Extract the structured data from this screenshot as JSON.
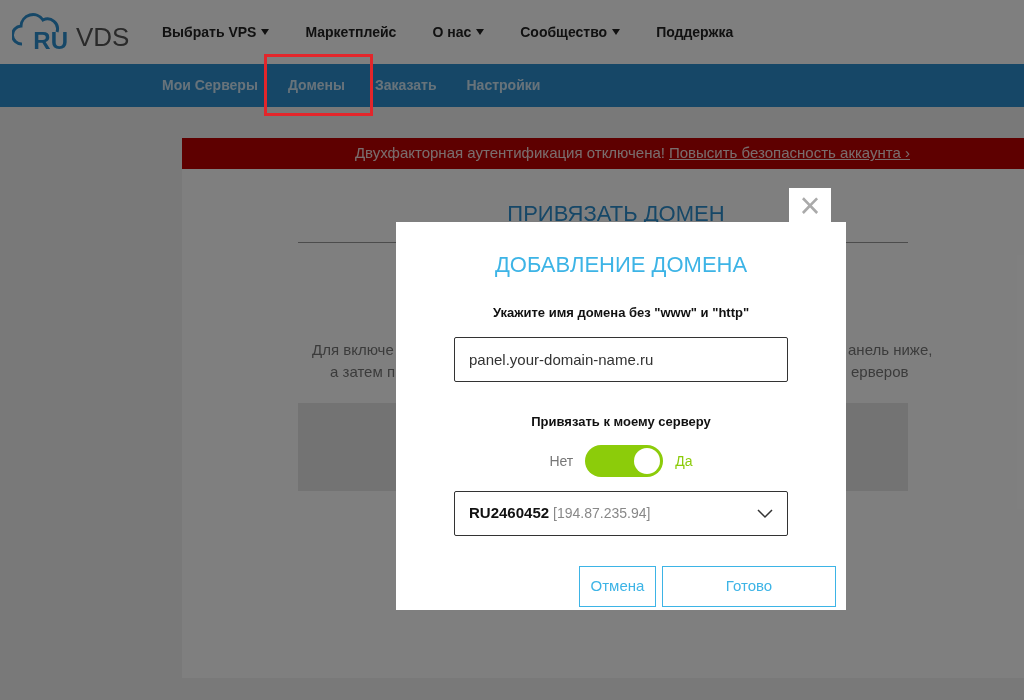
{
  "header": {
    "logo": {
      "mark": "RU",
      "text": "VDS"
    },
    "nav": [
      {
        "label": "Выбрать VPS",
        "dropdown": true
      },
      {
        "label": "Маркетплейс",
        "dropdown": false
      },
      {
        "label": "О нас",
        "dropdown": true
      },
      {
        "label": "Сообщество",
        "dropdown": true
      },
      {
        "label": "Поддержка",
        "dropdown": false
      }
    ]
  },
  "subnav": [
    {
      "label": "Мои Серверы",
      "selected": false,
      "highlighted": false
    },
    {
      "label": "Домены",
      "selected": false,
      "highlighted": true
    },
    {
      "label": "Заказать",
      "selected": false,
      "highlighted": false
    },
    {
      "label": "Настройки",
      "selected": false,
      "highlighted": false
    }
  ],
  "banner": {
    "text": "Двухфакторная аутентификация отключена!",
    "link": "Повысить безопасность аккаунта ›"
  },
  "page": {
    "title": "ПРИВЯЗАТЬ ДОМЕН",
    "text_fragments_left": [
      "Для включе",
      "а затем п"
    ],
    "text_fragments_right": [
      "анель ниже,",
      "ерверов"
    ]
  },
  "dialog": {
    "close": "×",
    "title": "ДОБАВЛЕНИЕ ДОМЕНА",
    "domain_label": "Укажите имя домена без \"www\" и \"http\"",
    "domain_value": "panel.your-domain-name.ru",
    "bind_label": "Привязать к моему серверу",
    "toggle": {
      "off_label": "Нет",
      "on_label": "Да",
      "on": true
    },
    "server": {
      "id": "RU2460452",
      "ip": "[194.87.235.94]"
    },
    "buttons": [
      {
        "label": "Отмена",
        "kind": "secondary"
      },
      {
        "label": "Готово",
        "kind": "primary"
      }
    ]
  }
}
